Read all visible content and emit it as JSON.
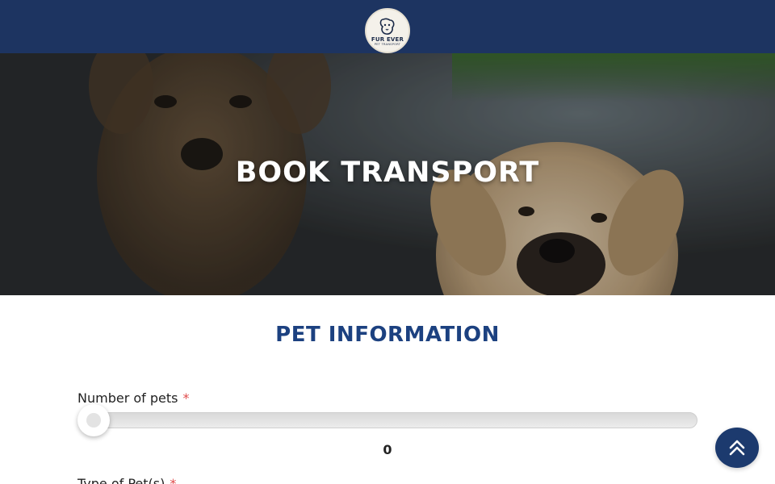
{
  "header": {
    "logo": {
      "name": "FUR EVER",
      "tagline": "PET TRANSPORT",
      "icon": "dog-paw-logo-icon"
    }
  },
  "hero": {
    "title": "BOOK TRANSPORT",
    "image": "puppies-photo"
  },
  "form": {
    "section_title": "PET INFORMATION",
    "number_of_pets": {
      "label": "Number of pets",
      "required_mark": "*",
      "value": "0",
      "min": 0
    },
    "type_of_pets": {
      "label": "Type of Pet(s)",
      "required_mark": "*"
    }
  },
  "scroll_top": {
    "icon": "double-chevron-up-icon"
  },
  "colors": {
    "header_bg": "#1d3461",
    "section_title": "#1c4180",
    "required": "#e04b4b",
    "scroll_button": "#1c3a6e"
  }
}
